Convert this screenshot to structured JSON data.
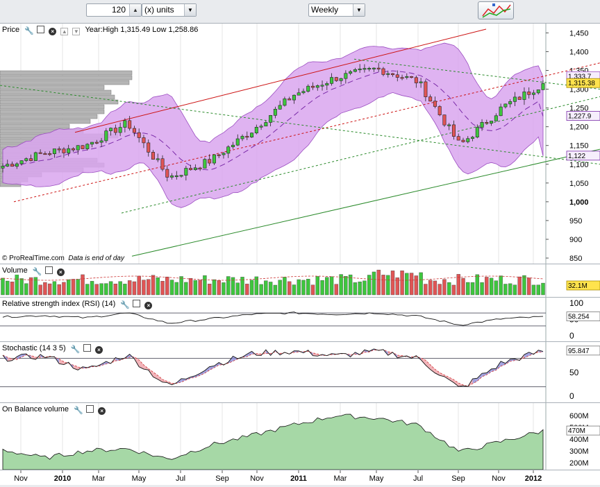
{
  "toolbar": {
    "units_value": "120",
    "units_label": "(x) units",
    "timeframe": "Weekly"
  },
  "price_panel": {
    "label": "Price",
    "info": "Year:High 1,315.49 Low 1,258.86",
    "y_ticks": [
      "1,450",
      "1,400",
      "1,350",
      "1,300",
      "1,250",
      "1,200",
      "1,150",
      "1,100",
      "1,050",
      "1,000",
      "950",
      "900",
      "850"
    ],
    "last_price": "1,315.38",
    "upper_band": "1,333.7",
    "mid_band": "1,227.9",
    "lower_band": "1,122",
    "watermark": "© ProRealTime.com",
    "note": "Data is end of day",
    "colors": {
      "band_fill": "#d9a6ee",
      "up": "#3ec63e",
      "down": "#e05555",
      "last_bg": "#ffe34d"
    }
  },
  "volume_panel": {
    "label": "Volume",
    "last": "32.1M"
  },
  "rsi_panel": {
    "label": "Relative strength index (RSI) (14)",
    "last": "58.254",
    "y_ticks": [
      "100",
      "50",
      "0"
    ]
  },
  "stoch_panel": {
    "label": "Stochastic (14 3 5)",
    "last": "95.847",
    "y_ticks": [
      "100",
      "50",
      "0"
    ]
  },
  "obv_panel": {
    "label": "On Balance volume",
    "last": "470M",
    "y_ticks": [
      "600M",
      "500M",
      "400M",
      "300M",
      "200M"
    ]
  },
  "x_axis": [
    "Nov",
    "2010",
    "Mar",
    "May",
    "Jul",
    "Sep",
    "Nov",
    "2011",
    "Mar",
    "May",
    "Jul",
    "Sep",
    "Nov",
    "2012"
  ],
  "chart_data": {
    "type": "candlestick",
    "interval": "weekly",
    "x": [
      "Nov 2009",
      "2010",
      "Mar 2010",
      "May 2010",
      "Jul 2010",
      "Sep 2010",
      "Nov 2010",
      "2011",
      "Mar 2011",
      "May 2011",
      "Jul 2011",
      "Sep 2011",
      "Nov 2011",
      "2012"
    ],
    "close": [
      1095,
      1130,
      1150,
      1210,
      1065,
      1110,
      1190,
      1285,
      1330,
      1355,
      1320,
      1150,
      1250,
      1315
    ],
    "ylim": [
      850,
      1460
    ],
    "bollinger": {
      "upper": 1333.7,
      "middle": 1227.9,
      "lower": 1122
    },
    "last": 1315.38,
    "year_high": 1315.49,
    "year_low": 1258.86,
    "volume_last": "32.1M",
    "rsi": [
      58,
      62,
      55,
      70,
      38,
      52,
      66,
      70,
      66,
      70,
      60,
      33,
      52,
      58.254
    ],
    "stochastic": [
      80,
      85,
      55,
      88,
      20,
      65,
      90,
      95,
      85,
      95,
      80,
      15,
      70,
      95.847
    ],
    "obv_millions": [
      310,
      240,
      300,
      320,
      230,
      350,
      430,
      520,
      600,
      580,
      520,
      290,
      380,
      470
    ]
  }
}
